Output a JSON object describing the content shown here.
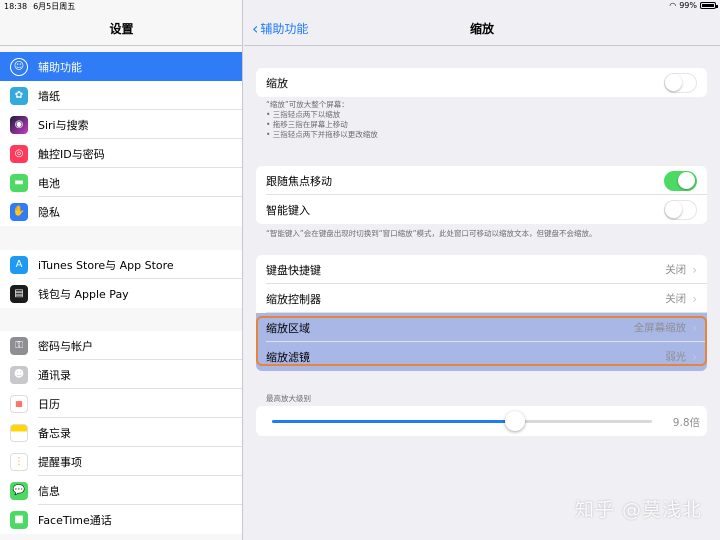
{
  "status_bar": {
    "time": "18:38",
    "date": "6月5日周五",
    "battery": "99%"
  },
  "sidebar": {
    "title": "设置",
    "group1": [
      {
        "label": "辅助功能",
        "icon": "accessibility-icon",
        "color": "#2f7cf6",
        "selected": true
      },
      {
        "label": "墙纸",
        "icon": "wallpaper-icon",
        "color": "#34aadc"
      },
      {
        "label": "Siri与搜索",
        "icon": "siri-icon",
        "color": "#1c1c3c"
      },
      {
        "label": "触控ID与密码",
        "icon": "fingerprint-icon",
        "color": "#ff3b5c"
      },
      {
        "label": "电池",
        "icon": "battery-icon",
        "color": "#4cd964"
      },
      {
        "label": "隐私",
        "icon": "hand-icon",
        "color": "#2f7cf6"
      }
    ],
    "group2": [
      {
        "label": "iTunes Store与 App Store",
        "icon": "app-store-icon",
        "color": "#1e9bf0"
      },
      {
        "label": "钱包与 Apple Pay",
        "icon": "wallet-icon",
        "color": "#1c1c1c"
      }
    ],
    "group3": [
      {
        "label": "密码与帐户",
        "icon": "key-icon",
        "color": "#8e8e93"
      },
      {
        "label": "通讯录",
        "icon": "contacts-icon",
        "color": "#b0b0b0"
      },
      {
        "label": "日历",
        "icon": "calendar-icon",
        "color": "#ffffff"
      },
      {
        "label": "备忘录",
        "icon": "notes-icon",
        "color": "#ffd60a"
      },
      {
        "label": "提醒事项",
        "icon": "reminders-icon",
        "color": "#ffffff"
      },
      {
        "label": "信息",
        "icon": "messages-icon",
        "color": "#4cd964"
      },
      {
        "label": "FaceTime通话",
        "icon": "facetime-icon",
        "color": "#4cd964"
      }
    ]
  },
  "main": {
    "back_label": "辅助功能",
    "title": "缩放",
    "zoom_row": {
      "label": "缩放",
      "on": false
    },
    "zoom_note": [
      "“缩放”可放大整个屏幕：",
      "• 三指轻点两下以缩放",
      "• 拖移三指在屏幕上移动",
      "• 三指轻点两下并拖移以更改缩放"
    ],
    "follow_row": {
      "label": "跟随焦点移动",
      "on": true
    },
    "smart_row": {
      "label": "智能键入",
      "on": false
    },
    "smart_note": "“智能键入”会在键盘出现时切换到“窗口缩放”模式，此处窗口可移动以缩放文本，但键盘不会缩放。",
    "rows": [
      {
        "label": "键盘快捷键",
        "value": "关闭"
      },
      {
        "label": "缩放控制器",
        "value": "关闭"
      },
      {
        "label": "缩放区域",
        "value": "全屏幕缩放"
      },
      {
        "label": "缩放滤镜",
        "value": "弱光"
      }
    ],
    "max_zoom_label": "最高放大级别",
    "max_zoom_value": "9.8倍",
    "max_zoom_fraction": 0.64
  },
  "watermark": "知乎 @莫浅北",
  "colors": {
    "accent": "#2f7cf6",
    "toggle_on": "#4cd964",
    "highlight": "#a9b7e6",
    "highlight_border": "#e8833a"
  }
}
